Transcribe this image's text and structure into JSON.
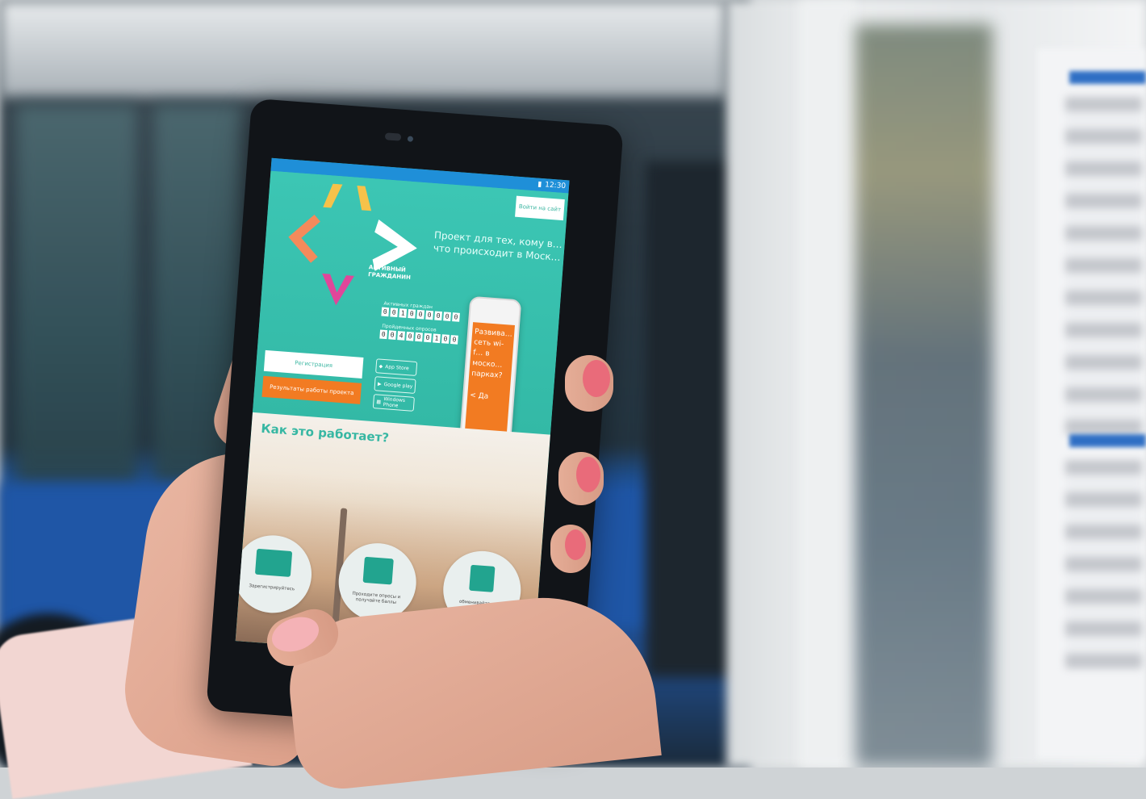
{
  "status_bar": {
    "time": "12:30"
  },
  "app": {
    "login_button": "Войти на сайт",
    "tagline": "Проект для тех, кому в… что происходит в Моск…",
    "brand_line1": "АКТИВНЫЙ",
    "brand_line2": "ГРАЖДАНИН",
    "counter1_label": "Активных граждан",
    "counter1_digits": [
      "0",
      "0",
      "1",
      "0",
      "0",
      "0",
      "0",
      "0",
      "0"
    ],
    "counter2_label": "Пройденных опросов",
    "counter2_digits": [
      "0",
      "0",
      "4",
      "0",
      "0",
      "0",
      "1",
      "0",
      "0"
    ],
    "register_button": "Регистрация",
    "results_button": "Результаты работы проекта",
    "stores": [
      "App Store",
      "Google play",
      "Windows Phone"
    ],
    "promo": "Развива… сеть wi-f… в моско… парках?",
    "promo_yes": "< Да",
    "how_title": "Как это работает?",
    "steps": [
      {
        "label": "Зарегистрируйтесь",
        "icon": "id-card-icon"
      },
      {
        "label": "Проходите опросы и получайте баллы",
        "icon": "touch-screen-icon"
      },
      {
        "label": "обменивайте … на городск…",
        "icon": "museum-icon"
      }
    ]
  },
  "colors": {
    "teal": "#38c2ad",
    "orange": "#f27b22",
    "status_blue": "#1f8fd8",
    "logo_yellow": "#f6c24a",
    "logo_orange": "#f48a5b",
    "logo_magenta": "#e0469a"
  }
}
